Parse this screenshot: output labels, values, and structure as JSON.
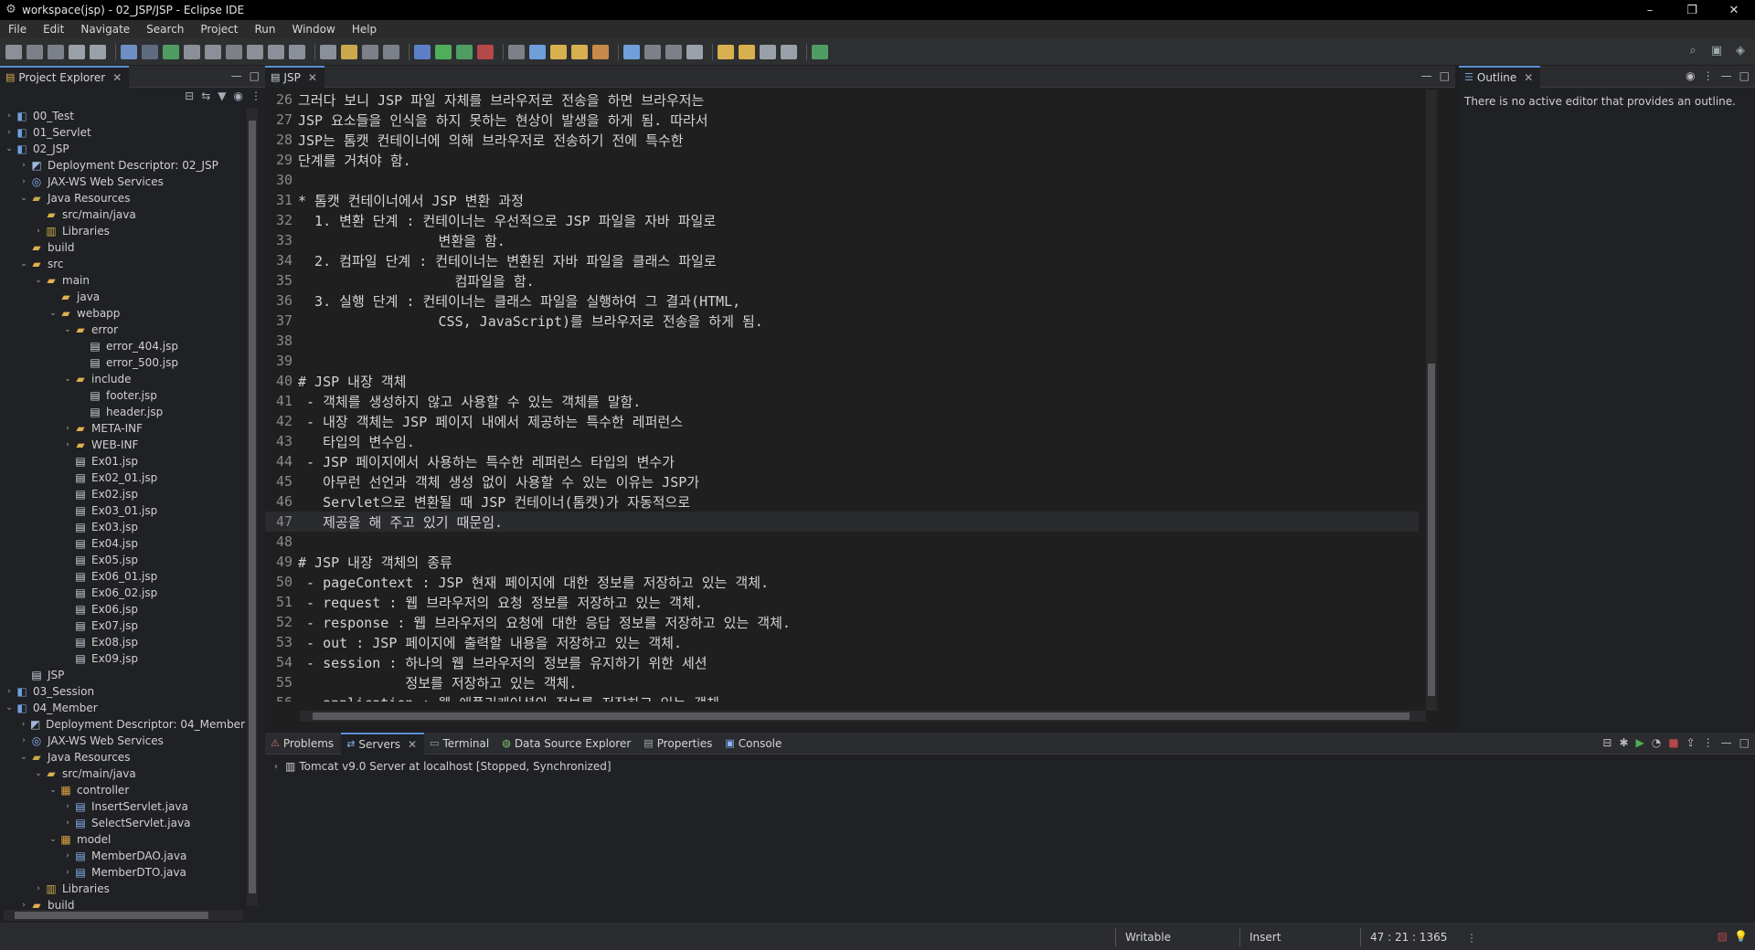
{
  "window": {
    "title": "workspace(jsp) - 02_JSP/JSP - Eclipse IDE",
    "controls": {
      "minimize": "–",
      "maximize": "❐",
      "close": "✕"
    }
  },
  "menu": [
    "File",
    "Edit",
    "Navigate",
    "Search",
    "Project",
    "Run",
    "Window",
    "Help"
  ],
  "project_explorer": {
    "tab_label": "Project Explorer",
    "items": [
      {
        "depth": 0,
        "arrow": "›",
        "icon": "project-icon",
        "label": "00_Test"
      },
      {
        "depth": 0,
        "arrow": "›",
        "icon": "project-icon",
        "label": "01_Servlet"
      },
      {
        "depth": 0,
        "arrow": "⌄",
        "icon": "project-icon",
        "label": "02_JSP"
      },
      {
        "depth": 1,
        "arrow": "›",
        "icon": "descriptor-icon",
        "label": "Deployment Descriptor: 02_JSP"
      },
      {
        "depth": 1,
        "arrow": "›",
        "icon": "webservice-icon",
        "label": "JAX-WS Web Services"
      },
      {
        "depth": 1,
        "arrow": "⌄",
        "icon": "java-resources-icon",
        "label": "Java Resources"
      },
      {
        "depth": 2,
        "arrow": "",
        "icon": "source-folder-icon",
        "label": "src/main/java"
      },
      {
        "depth": 2,
        "arrow": "›",
        "icon": "library-icon",
        "label": "Libraries"
      },
      {
        "depth": 1,
        "arrow": "",
        "icon": "folder-icon",
        "label": "build"
      },
      {
        "depth": 1,
        "arrow": "⌄",
        "icon": "folder-icon",
        "label": "src"
      },
      {
        "depth": 2,
        "arrow": "⌄",
        "icon": "folder-icon",
        "label": "main"
      },
      {
        "depth": 3,
        "arrow": "",
        "icon": "folder-icon",
        "label": "java"
      },
      {
        "depth": 3,
        "arrow": "⌄",
        "icon": "folder-icon",
        "label": "webapp"
      },
      {
        "depth": 4,
        "arrow": "⌄",
        "icon": "folder-icon",
        "label": "error"
      },
      {
        "depth": 5,
        "arrow": "",
        "icon": "file-icon",
        "label": "error_404.jsp"
      },
      {
        "depth": 5,
        "arrow": "",
        "icon": "file-icon",
        "label": "error_500.jsp"
      },
      {
        "depth": 4,
        "arrow": "⌄",
        "icon": "folder-icon",
        "label": "include"
      },
      {
        "depth": 5,
        "arrow": "",
        "icon": "file-icon",
        "label": "footer.jsp"
      },
      {
        "depth": 5,
        "arrow": "",
        "icon": "file-icon",
        "label": "header.jsp"
      },
      {
        "depth": 4,
        "arrow": "›",
        "icon": "folder-icon",
        "label": "META-INF"
      },
      {
        "depth": 4,
        "arrow": "›",
        "icon": "folder-icon",
        "label": "WEB-INF"
      },
      {
        "depth": 4,
        "arrow": "",
        "icon": "file-icon",
        "label": "Ex01.jsp"
      },
      {
        "depth": 4,
        "arrow": "",
        "icon": "file-icon",
        "label": "Ex02_01.jsp"
      },
      {
        "depth": 4,
        "arrow": "",
        "icon": "file-icon",
        "label": "Ex02.jsp"
      },
      {
        "depth": 4,
        "arrow": "",
        "icon": "file-icon",
        "label": "Ex03_01.jsp"
      },
      {
        "depth": 4,
        "arrow": "",
        "icon": "file-icon",
        "label": "Ex03.jsp"
      },
      {
        "depth": 4,
        "arrow": "",
        "icon": "file-icon",
        "label": "Ex04.jsp"
      },
      {
        "depth": 4,
        "arrow": "",
        "icon": "file-icon",
        "label": "Ex05.jsp"
      },
      {
        "depth": 4,
        "arrow": "",
        "icon": "file-icon",
        "label": "Ex06_01.jsp"
      },
      {
        "depth": 4,
        "arrow": "",
        "icon": "file-icon",
        "label": "Ex06_02.jsp"
      },
      {
        "depth": 4,
        "arrow": "",
        "icon": "file-icon",
        "label": "Ex06.jsp"
      },
      {
        "depth": 4,
        "arrow": "",
        "icon": "file-icon",
        "label": "Ex07.jsp"
      },
      {
        "depth": 4,
        "arrow": "",
        "icon": "file-icon",
        "label": "Ex08.jsp"
      },
      {
        "depth": 4,
        "arrow": "",
        "icon": "file-icon",
        "label": "Ex09.jsp"
      },
      {
        "depth": 1,
        "arrow": "",
        "icon": "file-icon",
        "label": "JSP"
      },
      {
        "depth": 0,
        "arrow": "›",
        "icon": "project-icon",
        "label": "03_Session"
      },
      {
        "depth": 0,
        "arrow": "⌄",
        "icon": "project-icon",
        "label": "04_Member"
      },
      {
        "depth": 1,
        "arrow": "›",
        "icon": "descriptor-icon",
        "label": "Deployment Descriptor: 04_Member"
      },
      {
        "depth": 1,
        "arrow": "›",
        "icon": "webservice-icon",
        "label": "JAX-WS Web Services"
      },
      {
        "depth": 1,
        "arrow": "⌄",
        "icon": "java-resources-icon",
        "label": "Java Resources"
      },
      {
        "depth": 2,
        "arrow": "⌄",
        "icon": "source-folder-icon",
        "label": "src/main/java"
      },
      {
        "depth": 3,
        "arrow": "⌄",
        "icon": "package-icon",
        "label": "controller"
      },
      {
        "depth": 4,
        "arrow": "›",
        "icon": "java-file-icon",
        "label": "InsertServlet.java"
      },
      {
        "depth": 4,
        "arrow": "›",
        "icon": "java-file-icon",
        "label": "SelectServlet.java"
      },
      {
        "depth": 3,
        "arrow": "⌄",
        "icon": "package-icon",
        "label": "model"
      },
      {
        "depth": 4,
        "arrow": "›",
        "icon": "java-file-icon",
        "label": "MemberDAO.java"
      },
      {
        "depth": 4,
        "arrow": "›",
        "icon": "java-file-icon",
        "label": "MemberDTO.java"
      },
      {
        "depth": 2,
        "arrow": "›",
        "icon": "library-icon",
        "label": "Libraries"
      },
      {
        "depth": 1,
        "arrow": "›",
        "icon": "folder-icon",
        "label": "build"
      }
    ]
  },
  "editor": {
    "tab_label": "JSP",
    "current_line": 47,
    "lines": [
      {
        "n": "26",
        "text": "그러다 보니 JSP 파일 자체를 브라우저로 전송을 하면 브라우저는"
      },
      {
        "n": "27",
        "text": "JSP 요소들을 인식을 하지 못하는 현상이 발생을 하게 됨. 따라서"
      },
      {
        "n": "28",
        "text": "JSP는 톰캣 컨테이너에 의해 브라우저로 전송하기 전에 특수한"
      },
      {
        "n": "29",
        "text": "단계를 거쳐야 함."
      },
      {
        "n": "30",
        "text": ""
      },
      {
        "n": "31",
        "text": "* 톰캣 컨테이너에서 JSP 변환 과정"
      },
      {
        "n": "32",
        "text": "  1. 변환 단계 : 컨테이너는 우선적으로 JSP 파일을 자바 파일로"
      },
      {
        "n": "33",
        "text": "                 변환을 함."
      },
      {
        "n": "34",
        "text": "  2. 컴파일 단계 : 컨테이너는 변환된 자바 파일을 클래스 파일로"
      },
      {
        "n": "35",
        "text": "                   컴파일을 함."
      },
      {
        "n": "36",
        "text": "  3. 실행 단계 : 컨테이너는 클래스 파일을 실행하여 그 결과(HTML,"
      },
      {
        "n": "37",
        "text": "                 CSS, JavaScript)를 브라우저로 전송을 하게 됨."
      },
      {
        "n": "38",
        "text": ""
      },
      {
        "n": "39",
        "text": ""
      },
      {
        "n": "40",
        "text": "# JSP 내장 객체"
      },
      {
        "n": "41",
        "text": " - 객체를 생성하지 않고 사용할 수 있는 객체를 말함."
      },
      {
        "n": "42",
        "text": " - 내장 객체는 JSP 페이지 내에서 제공하는 특수한 레퍼런스"
      },
      {
        "n": "43",
        "text": "   타입의 변수임."
      },
      {
        "n": "44",
        "text": " - JSP 페이지에서 사용하는 특수한 레퍼런스 타입의 변수가"
      },
      {
        "n": "45",
        "text": "   아무런 선언과 객체 생성 없이 사용할 수 있는 이유는 JSP가"
      },
      {
        "n": "46",
        "text": "   Servlet으로 변환될 때 JSP 컨테이너(톰캣)가 자동적으로"
      },
      {
        "n": "47",
        "text": "   제공을 해 주고 있기 때문임."
      },
      {
        "n": "48",
        "text": ""
      },
      {
        "n": "49",
        "text": "# JSP 내장 객체의 종류"
      },
      {
        "n": "50",
        "text": " - pageContext : JSP 현재 페이지에 대한 정보를 저장하고 있는 객체."
      },
      {
        "n": "51",
        "text": " - request : 웹 브라우저의 요청 정보를 저장하고 있는 객체."
      },
      {
        "n": "52",
        "text": " - response : 웹 브라우저의 요청에 대한 응답 정보를 저장하고 있는 객체."
      },
      {
        "n": "53",
        "text": " - out : JSP 페이지에 출력할 내용을 저장하고 있는 객체."
      },
      {
        "n": "54",
        "text": " - session : 하나의 웹 브라우저의 정보를 유지하기 위한 세션"
      },
      {
        "n": "55",
        "text": "             정보를 저장하고 있는 객체."
      },
      {
        "n": "56",
        "text": " - application : 웹 애플리케이션의 정보를 저장하고 있는 객체."
      }
    ]
  },
  "outline": {
    "tab_label": "Outline",
    "message": "There is no active editor that provides an outline."
  },
  "bottom_panel": {
    "tabs": [
      {
        "label": "Problems",
        "icon": "problems-icon"
      },
      {
        "label": "Servers",
        "icon": "servers-icon",
        "active": true
      },
      {
        "label": "Terminal",
        "icon": "terminal-icon"
      },
      {
        "label": "Data Source Explorer",
        "icon": "datasource-icon"
      },
      {
        "label": "Properties",
        "icon": "properties-icon"
      },
      {
        "label": "Console",
        "icon": "console-icon"
      }
    ],
    "server_entry": "Tomcat v9.0 Server at localhost  [Stopped, Synchronized]"
  },
  "status": {
    "writable": "Writable",
    "insert_mode": "Insert",
    "position": "47 : 21 : 1365"
  },
  "colors": {
    "active_tab_accent": "#5a8fd8",
    "folder": "#e0b050",
    "project": "#6f9fd8",
    "java_file": "#8ab4f8"
  }
}
